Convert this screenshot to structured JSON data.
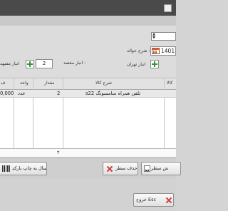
{
  "form": {
    "spin_value": "",
    "date_value": "1401",
    "transfer_desc_label": "شرح حواله :",
    "destination_label": "انبار مقصد :",
    "destination_value": "2",
    "tehran_label": "انبار تهران",
    "mashhad_label": "انبار مشهد"
  },
  "grid": {
    "columns": {
      "item": "کالا",
      "item_desc": "شرح کالا",
      "quantity": "مقدار",
      "unit": "واحد",
      "price": "ف"
    },
    "rows": [
      {
        "item_desc": "s22 تلفن همراه سامسونگ",
        "quantity": "2",
        "unit": "عدد",
        "price": "0,000"
      }
    ],
    "footer_quantity_total": "۲"
  },
  "buttons": {
    "insert_row": "ش سطر",
    "delete_row": "حذف سطر",
    "send_barcode": "ارسال به چاپ بارکد",
    "exit": "خروج Esc"
  },
  "colors": {
    "titlebar": "#4a4a4a",
    "plus_icon": "#2f9a2f",
    "delete_icon": "#d23b3b"
  }
}
